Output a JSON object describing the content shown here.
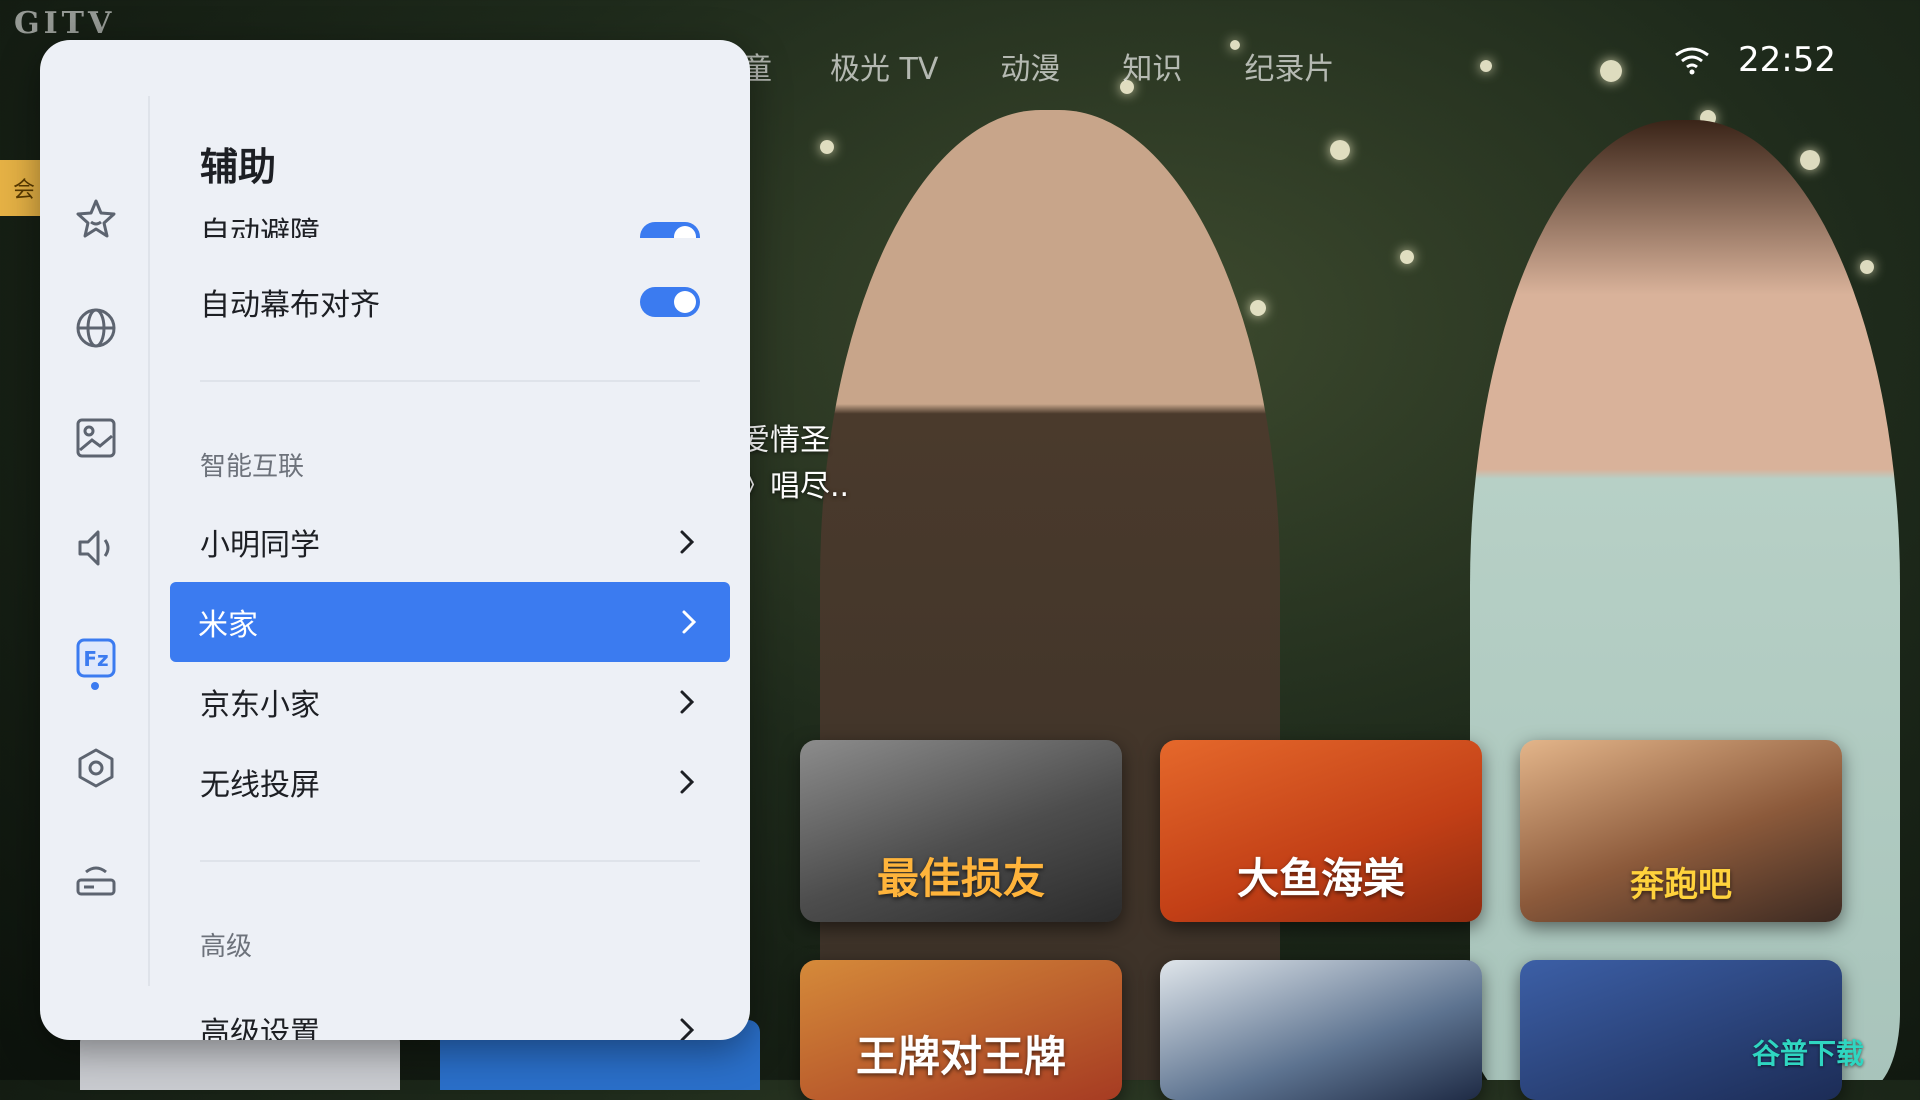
{
  "brand": {
    "logo": "GITV"
  },
  "top_nav": {
    "partial_item": "童",
    "items": [
      "极光 TV",
      "动漫",
      "知识",
      "纪录片"
    ]
  },
  "status_bar": {
    "time": "22:52",
    "wifi_icon": "wifi-icon"
  },
  "vip_badge": "会",
  "hero": {
    "line1": "爱情圣",
    "line2": "》唱尽.."
  },
  "posters": [
    {
      "title": "最佳损友"
    },
    {
      "title": "大鱼海棠"
    },
    {
      "title": "奔跑吧"
    },
    {
      "title": "王牌对王牌"
    },
    {
      "title": ""
    },
    {
      "title": ""
    }
  ],
  "watermark": "谷普下载",
  "settings_panel": {
    "title": "辅助",
    "rail_icons": [
      "star-icon",
      "globe-icon",
      "image-icon",
      "speaker-icon",
      "assist-icon",
      "hexagon-settings-icon",
      "router-icon"
    ],
    "rows": {
      "auto_obstacle": {
        "label": "自动避障",
        "enabled": true
      },
      "auto_screen_align": {
        "label": "自动幕布对齐",
        "enabled": true
      }
    },
    "sections": {
      "smart_connect": {
        "label": "智能互联",
        "items": [
          {
            "label": "小明同学"
          },
          {
            "label": "米家",
            "selected": true
          },
          {
            "label": "京东小家"
          },
          {
            "label": "无线投屏"
          }
        ]
      },
      "advanced": {
        "label": "高级",
        "items": [
          {
            "label": "高级设置"
          }
        ]
      }
    },
    "accent_color": "#3b7bf0",
    "panel_color": "#edf0f6"
  }
}
